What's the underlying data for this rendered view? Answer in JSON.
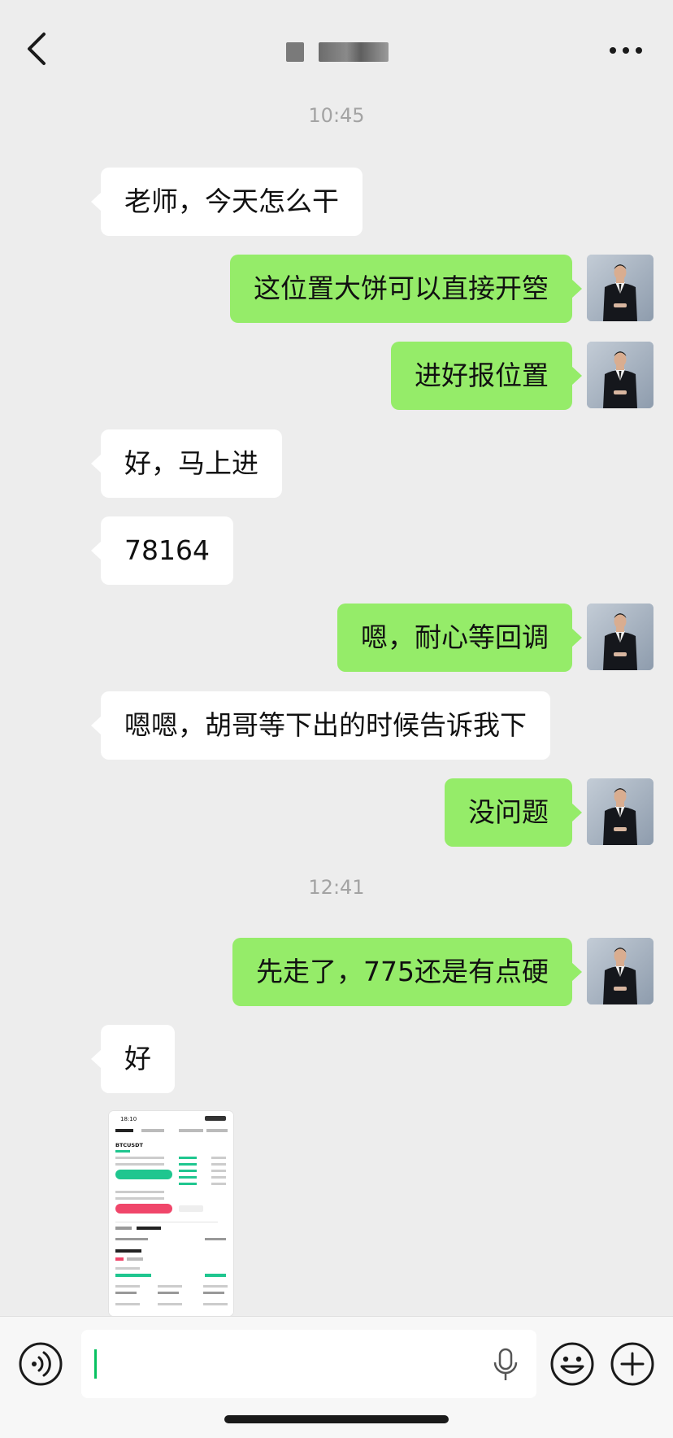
{
  "header": {
    "back_icon": "chevron-left-icon",
    "contact_name_masked": "",
    "more_icon": "more-dots-icon"
  },
  "timestamps": [
    "10:45",
    "12:41"
  ],
  "messages": [
    {
      "side": "in",
      "text": "老师，今天怎么干"
    },
    {
      "side": "out",
      "text": "这位置大饼可以直接开箜"
    },
    {
      "side": "out",
      "text": "进好报位置"
    },
    {
      "side": "in",
      "text": "好，马上进"
    },
    {
      "side": "in",
      "text": "78164"
    },
    {
      "side": "out",
      "text": "嗯，耐心等回调"
    },
    {
      "side": "in",
      "text": "嗯嗯，胡哥等下出的时候告诉我下"
    },
    {
      "side": "out",
      "text": "没问题"
    },
    {
      "side": "out",
      "text": "先走了，775还是有点硬"
    },
    {
      "side": "in",
      "text": "好"
    }
  ],
  "shared_image": {
    "type": "screenshot",
    "time": "18:10",
    "pair": "BTCUSDT"
  },
  "input_bar": {
    "voice_icon": "voice-icon",
    "mic_icon": "microphone-icon",
    "emoji_icon": "emoji-icon",
    "plus_icon": "plus-icon",
    "input_value": ""
  },
  "colors": {
    "background": "#ededed",
    "outgoing_bubble": "#95ec69",
    "incoming_bubble": "#ffffff",
    "caret": "#07c160"
  }
}
